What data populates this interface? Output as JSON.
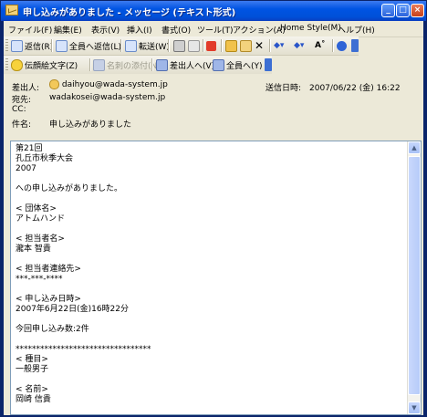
{
  "window": {
    "title": "申し込みがありました - メッセージ (テキスト形式)",
    "minimize_glyph": "_",
    "maximize_glyph": "□",
    "close_glyph": "×"
  },
  "menu": {
    "items": [
      "ファイル(F)",
      "編集(E)",
      "表示(V)",
      "挿入(I)",
      "書式(O)",
      "ツール(T)",
      "アクション(A)",
      "Home Style(M)",
      "ヘルプ(H)"
    ]
  },
  "toolbar1": {
    "reply": "返信(R)",
    "reply_all": "全員へ返信(L)",
    "forward": "転送(W)"
  },
  "toolbar2": {
    "emoticon": "伝顔絵文字(Z)",
    "name_attach": "名刺の添付(N)",
    "to_sender": "差出人へ(V)",
    "to_all": "全員へ(Y)"
  },
  "header": {
    "from_label": "差出人:",
    "from_value": "daihyou@wada-system.jp",
    "sent_label": "送信日時:",
    "sent_value": "2007/06/22 (金) 16:22",
    "to_label": "宛先:",
    "to_value": "wadakosei@wada-system.jp",
    "cc_label": "CC:",
    "cc_value": "",
    "subject_label": "件名:",
    "subject_value": "申し込みがありました"
  },
  "body": "第21回\n孔丘市秋季大会\n2007\n\nへの申し込みがありました。\n\n< 団体名>\nアトムハンド\n\n< 担当者名>\n瀧本 智貴\n\n< 担当者連絡先>\n***-***-****\n\n< 申し込み日時>\n2007年6月22日(金)16時22分\n\n今回申し込み数:2件\n\n*********************************\n< 種目>\n一般男子\n\n< 名前>\n岡崎 信貴",
  "colors": {
    "titlebar": "#0054e3",
    "chrome": "#ece9d8"
  }
}
